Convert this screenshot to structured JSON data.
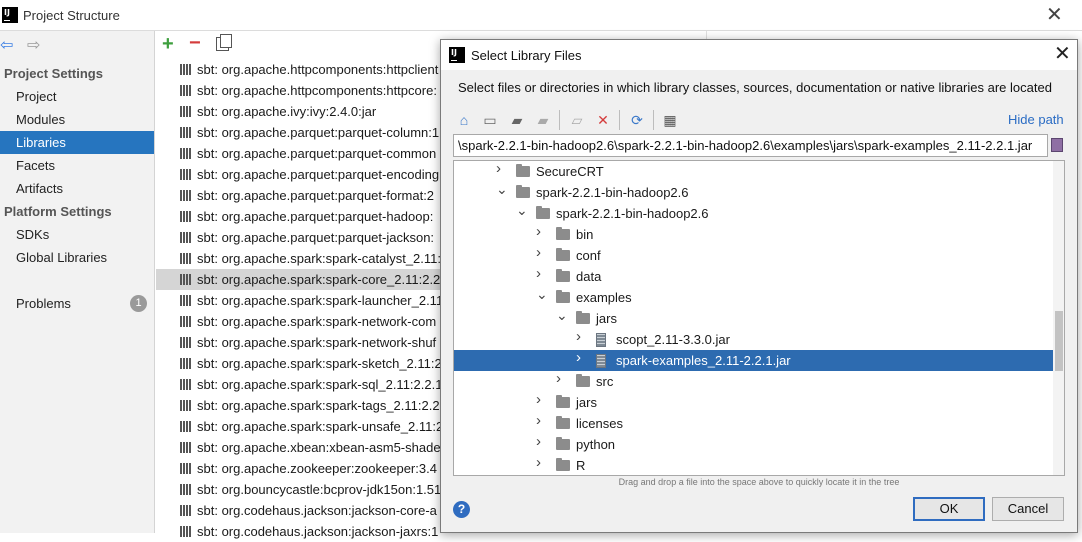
{
  "main_window": {
    "title": "Project Structure",
    "close_glyph": "✕"
  },
  "sidebar": {
    "project_settings_header": "Project Settings",
    "project_settings_items": [
      "Project",
      "Modules",
      "Libraries",
      "Facets",
      "Artifacts"
    ],
    "selected_item": "Libraries",
    "platform_settings_header": "Platform Settings",
    "platform_settings_items": [
      "SDKs",
      "Global Libraries"
    ],
    "problems_label": "Problems",
    "problems_count": "1"
  },
  "libraries": {
    "add_glyph": "+",
    "remove_glyph": "−",
    "items": [
      "sbt: org.apache.httpcomponents:httpclient",
      "sbt: org.apache.httpcomponents:httpcore:",
      "sbt: org.apache.ivy:ivy:2.4.0:jar",
      "sbt: org.apache.parquet:parquet-column:1",
      "sbt: org.apache.parquet:parquet-common",
      "sbt: org.apache.parquet:parquet-encoding",
      "sbt: org.apache.parquet:parquet-format:2",
      "sbt: org.apache.parquet:parquet-hadoop:",
      "sbt: org.apache.parquet:parquet-jackson:",
      "sbt: org.apache.spark:spark-catalyst_2.11:",
      "sbt: org.apache.spark:spark-core_2.11:2.2",
      "sbt: org.apache.spark:spark-launcher_2.11",
      "sbt: org.apache.spark:spark-network-com",
      "sbt: org.apache.spark:spark-network-shuf",
      "sbt: org.apache.spark:spark-sketch_2.11:2",
      "sbt: org.apache.spark:spark-sql_2.11:2.2.1",
      "sbt: org.apache.spark:spark-tags_2.11:2.2",
      "sbt: org.apache.spark:spark-unsafe_2.11:2",
      "sbt: org.apache.xbean:xbean-asm5-shade",
      "sbt: org.apache.zookeeper:zookeeper:3.4",
      "sbt: org.bouncycastle:bcprov-jdk15on:1.51",
      "sbt: org.codehaus.jackson:jackson-core-a",
      "sbt: org.codehaus.jackson:jackson-jaxrs:1"
    ],
    "selected_index": 10
  },
  "dialog": {
    "title": "Select Library Files",
    "close_glyph": "✕",
    "description": "Select files or directories in which library classes, sources, documentation or native libraries are located",
    "hide_path_label": "Hide path",
    "path_value": "\\spark-2.2.1-bin-hadoop2.6\\spark-2.2.1-bin-hadoop2.6\\examples\\jars\\spark-examples_2.11-2.2.1.jar",
    "tree": [
      {
        "label": "SecureCRT",
        "depth": 0,
        "type": "folder",
        "expanded": false
      },
      {
        "label": "spark-2.2.1-bin-hadoop2.6",
        "depth": 0,
        "type": "folder",
        "expanded": true
      },
      {
        "label": "spark-2.2.1-bin-hadoop2.6",
        "depth": 1,
        "type": "folder",
        "expanded": true
      },
      {
        "label": "bin",
        "depth": 2,
        "type": "folder",
        "expanded": false
      },
      {
        "label": "conf",
        "depth": 2,
        "type": "folder",
        "expanded": false
      },
      {
        "label": "data",
        "depth": 2,
        "type": "folder",
        "expanded": false
      },
      {
        "label": "examples",
        "depth": 2,
        "type": "folder",
        "expanded": true
      },
      {
        "label": "jars",
        "depth": 3,
        "type": "folder",
        "expanded": true
      },
      {
        "label": "scopt_2.11-3.3.0.jar",
        "depth": 4,
        "type": "jar",
        "expanded": false
      },
      {
        "label": "spark-examples_2.11-2.2.1.jar",
        "depth": 4,
        "type": "jar",
        "expanded": false,
        "selected": true
      },
      {
        "label": "src",
        "depth": 3,
        "type": "folder",
        "expanded": false
      },
      {
        "label": "jars",
        "depth": 2,
        "type": "folder",
        "expanded": false
      },
      {
        "label": "licenses",
        "depth": 2,
        "type": "folder",
        "expanded": false
      },
      {
        "label": "python",
        "depth": 2,
        "type": "folder",
        "expanded": false
      },
      {
        "label": "R",
        "depth": 2,
        "type": "folder",
        "expanded": false
      }
    ],
    "drag_hint": "Drag and drop a file into the space above to quickly locate it in the tree",
    "help_glyph": "?",
    "ok_label": "OK",
    "cancel_label": "Cancel"
  }
}
